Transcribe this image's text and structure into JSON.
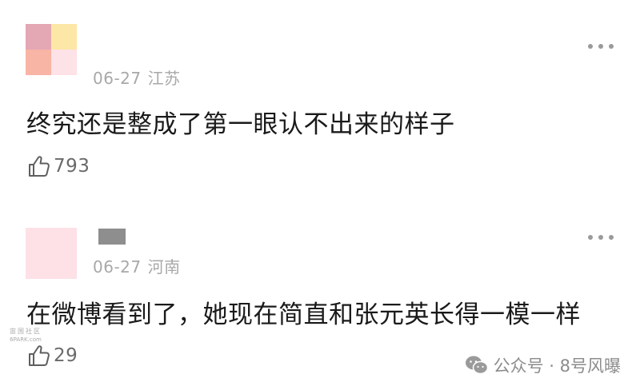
{
  "comments": [
    {
      "date": "06-27",
      "region": "江苏",
      "text": "终究还是整成了第一眼认不出来的样子",
      "likes": "793",
      "avatar_colors": [
        "#e3a8b3",
        "#fde7a6",
        "#f8b4a4",
        "#fde2e7"
      ]
    },
    {
      "date": "06-27",
      "region": "河南",
      "text": "在微博看到了，她现在简直和张元英长得一模一样",
      "likes": "29",
      "avatar_color": "#fde1e6",
      "name_block_color": "#8e8e8e"
    }
  ],
  "watermark": {
    "top": "宙国社区",
    "bottom": "6PARK.com"
  },
  "account": {
    "label": "公众号 · 8号风曝",
    "icon": "wechat-icon"
  },
  "icons": {
    "like": "thumbs-up-icon",
    "more": "more-dots-icon"
  },
  "colors": {
    "meta_text": "#a8a8a8",
    "body_text": "#1a1a1a",
    "like_count": "#6a6a6a"
  }
}
